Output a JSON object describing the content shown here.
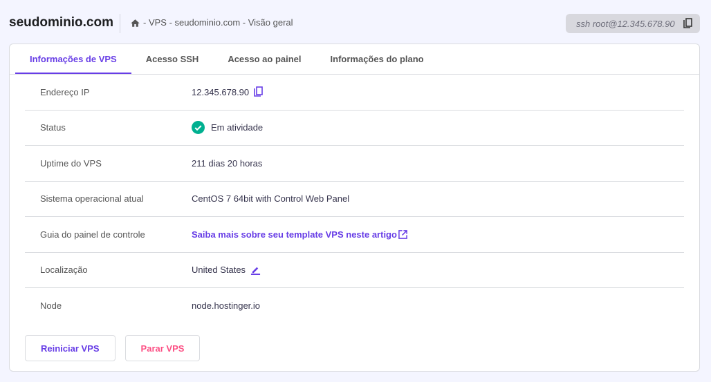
{
  "header": {
    "domain": "seudominio.com",
    "breadcrumb": "- VPS - seudominio.com - Visão geral",
    "ssh_command": "ssh root@12.345.678.90"
  },
  "tabs": [
    {
      "label": "Informações de VPS"
    },
    {
      "label": "Acesso SSH"
    },
    {
      "label": "Acesso ao painel"
    },
    {
      "label": "Informações do plano"
    }
  ],
  "rows": [
    {
      "label": "Endereço IP",
      "value": "12.345.678.90"
    },
    {
      "label": "Status",
      "value": "Em atividade"
    },
    {
      "label": "Uptime do VPS",
      "value": "211 dias 20 horas"
    },
    {
      "label": "Sistema operacional atual",
      "value": "CentOS 7 64bit with Control Web Panel"
    },
    {
      "label": "Guia do painel de controle",
      "value": "Saiba mais sobre seu template VPS neste artigo"
    },
    {
      "label": "Localização",
      "value": "United States"
    },
    {
      "label": "Node",
      "value": "node.hostinger.io"
    }
  ],
  "buttons": {
    "restart": "Reiniciar VPS",
    "stop": "Parar VPS"
  },
  "colors": {
    "accent": "#673de6",
    "success": "#00b090",
    "danger": "#fc5185"
  }
}
